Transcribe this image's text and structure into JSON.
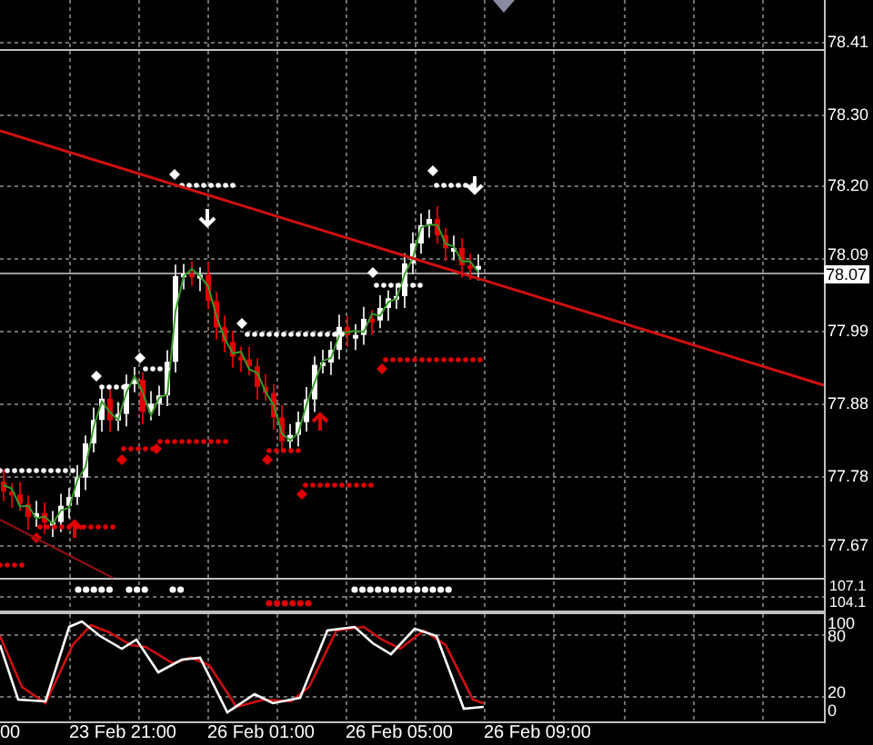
{
  "price_axis": {
    "labels": [
      "78.41",
      "78.30",
      "78.20",
      "78.09",
      "77.99",
      "77.88",
      "77.78",
      "77.67"
    ],
    "current_price": "78.07"
  },
  "indicator_panel": {
    "labels": [
      "107.1",
      "104.1"
    ]
  },
  "oscillator_panel": {
    "labels": [
      "100",
      "80",
      "20",
      "0"
    ]
  },
  "time_axis": {
    "labels": [
      "00",
      "23 Feb 21:00",
      "26 Feb 01:00",
      "26 Feb 05:00",
      "26 Feb 09:00"
    ]
  }
}
